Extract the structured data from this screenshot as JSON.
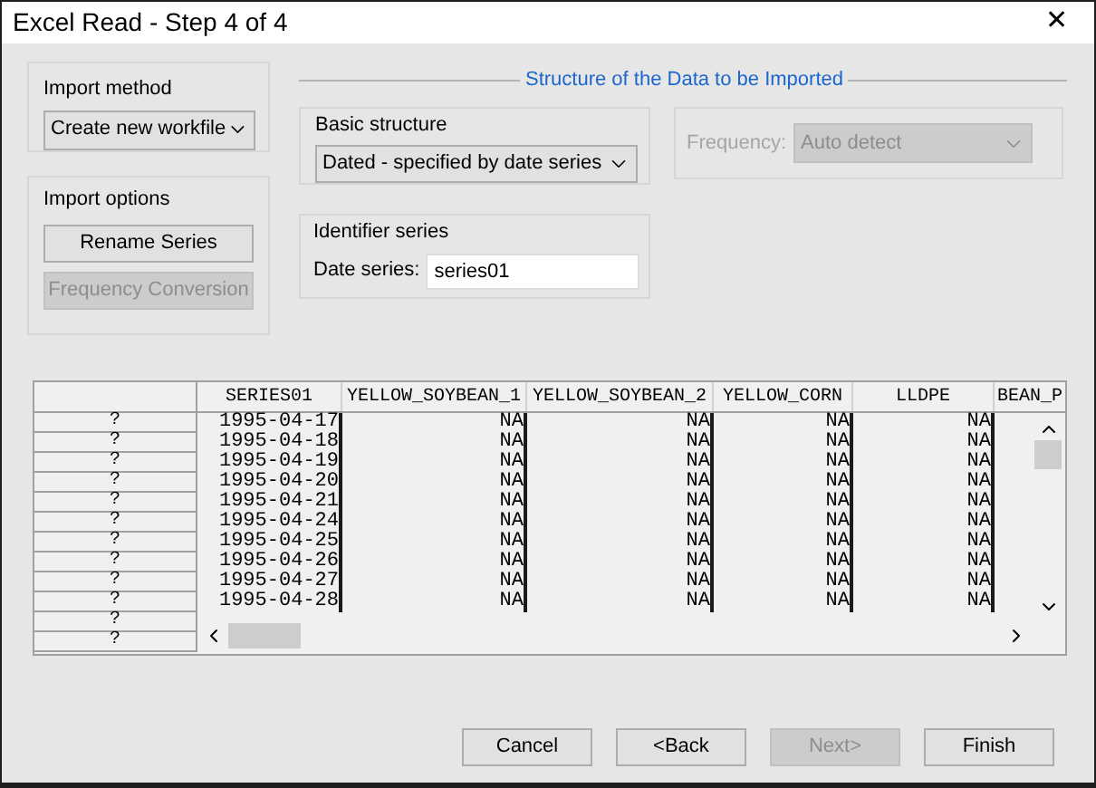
{
  "window": {
    "title": "Excel Read - Step 4 of 4",
    "close": "✕"
  },
  "import_method": {
    "legend": "Import method",
    "value": "Create new workfile"
  },
  "import_options": {
    "legend": "Import options",
    "buttons": [
      {
        "label": "Rename Series",
        "disabled": false
      },
      {
        "label": "Frequency Conversion",
        "disabled": true
      }
    ]
  },
  "structure": {
    "title": "Structure of the Data to be Imported",
    "basic": {
      "legend": "Basic structure",
      "value": "Dated - specified by date series"
    },
    "frequency": {
      "label": "Frequency:",
      "value": "Auto detect",
      "disabled": true
    },
    "identifier": {
      "legend": "Identifier series",
      "label": "Date series:",
      "value": "series01"
    }
  },
  "table": {
    "columns": [
      "SERIES01",
      "YELLOW_SOYBEAN_1",
      "YELLOW_SOYBEAN_2",
      "YELLOW_CORN",
      "LLDPE",
      "BEAN_P"
    ],
    "row_headers": [
      "?",
      "?",
      "?",
      "?",
      "?",
      "?",
      "?",
      "?",
      "?",
      "?",
      "?",
      "?"
    ],
    "rows": [
      [
        "1995-04-17",
        "NA",
        "NA",
        "NA",
        "NA"
      ],
      [
        "1995-04-18",
        "NA",
        "NA",
        "NA",
        "NA"
      ],
      [
        "1995-04-19",
        "NA",
        "NA",
        "NA",
        "NA"
      ],
      [
        "1995-04-20",
        "NA",
        "NA",
        "NA",
        "NA"
      ],
      [
        "1995-04-21",
        "NA",
        "NA",
        "NA",
        "NA"
      ],
      [
        "1995-04-24",
        "NA",
        "NA",
        "NA",
        "NA"
      ],
      [
        "1995-04-25",
        "NA",
        "NA",
        "NA",
        "NA"
      ],
      [
        "1995-04-26",
        "NA",
        "NA",
        "NA",
        "NA"
      ],
      [
        "1995-04-27",
        "NA",
        "NA",
        "NA",
        "NA"
      ],
      [
        "1995-04-28",
        "NA",
        "NA",
        "NA",
        "NA"
      ]
    ]
  },
  "buttons": [
    {
      "label": "Cancel",
      "disabled": false
    },
    {
      "label": "<Back",
      "disabled": false
    },
    {
      "label": "Next>",
      "disabled": true
    },
    {
      "label": "Finish",
      "disabled": false
    }
  ]
}
